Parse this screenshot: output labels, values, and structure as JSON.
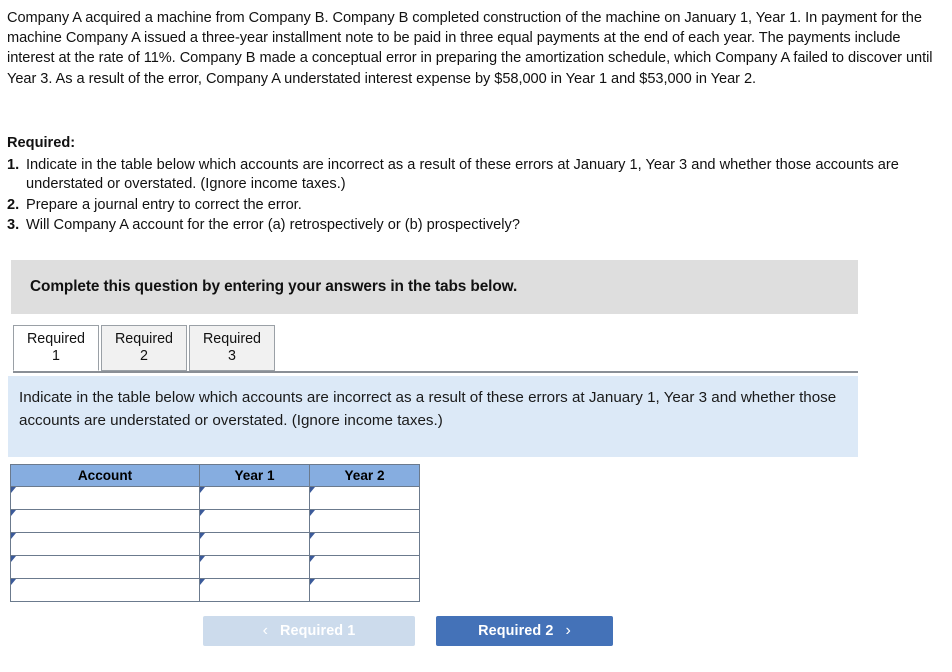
{
  "problem": {
    "paragraph": "Company A acquired a machine from Company B. Company B completed construction of the machine on January 1, Year 1. In payment for the machine Company A issued a three-year installment note to be paid in three equal payments at the end of each year. The payments include interest at the rate of 11%. Company B made a conceptual error in preparing the amortization schedule, which Company A failed to discover until Year 3. As a result of the error, Company A understated interest expense by $58,000 in Year 1 and $53,000 in Year 2."
  },
  "required": {
    "title": "Required:",
    "items": [
      {
        "num": "1.",
        "text": "Indicate in the table below which accounts are incorrect as a result of these errors at January 1, Year 3 and whether those accounts are understated or overstated. (Ignore income taxes.)"
      },
      {
        "num": "2.",
        "text": "Prepare a journal entry to correct the error."
      },
      {
        "num": "3.",
        "text": "Will Company A account for the error (a) retrospectively or (b) prospectively?"
      }
    ]
  },
  "banner": {
    "text": "Complete this question by entering your answers in the tabs below."
  },
  "tabs": [
    {
      "line1": "Required",
      "line2": "1",
      "active": true
    },
    {
      "line1": "Required",
      "line2": "2",
      "active": false
    },
    {
      "line1": "Required",
      "line2": "3",
      "active": false
    }
  ],
  "instruction": {
    "text": "Indicate in the table below which accounts are incorrect as a result of these errors at January 1, Year 3 and whether those accounts are understated or overstated. (Ignore income taxes.)"
  },
  "answer_table": {
    "columns": [
      "Account",
      "Year 1",
      "Year 2"
    ],
    "rows": [
      [
        "",
        "",
        ""
      ],
      [
        "",
        "",
        ""
      ],
      [
        "",
        "",
        ""
      ],
      [
        "",
        "",
        ""
      ],
      [
        "",
        "",
        ""
      ]
    ]
  },
  "nav": {
    "prev_label": "Required 1",
    "prev_icon": "chevron-left",
    "prev_glyph": "‹",
    "prev_disabled": true,
    "next_label": "Required 2",
    "next_icon": "chevron-right",
    "next_glyph": "›"
  },
  "colors": {
    "banner_gray": "#dedede",
    "panel_blue": "#dce9f7",
    "table_header_blue": "#86ade0",
    "button_active_blue": "#4472b8",
    "button_disabled_blue": "#ccdbec",
    "cell_marker_blue": "#3b5a9a",
    "border_gray": "#6b7a8d"
  }
}
